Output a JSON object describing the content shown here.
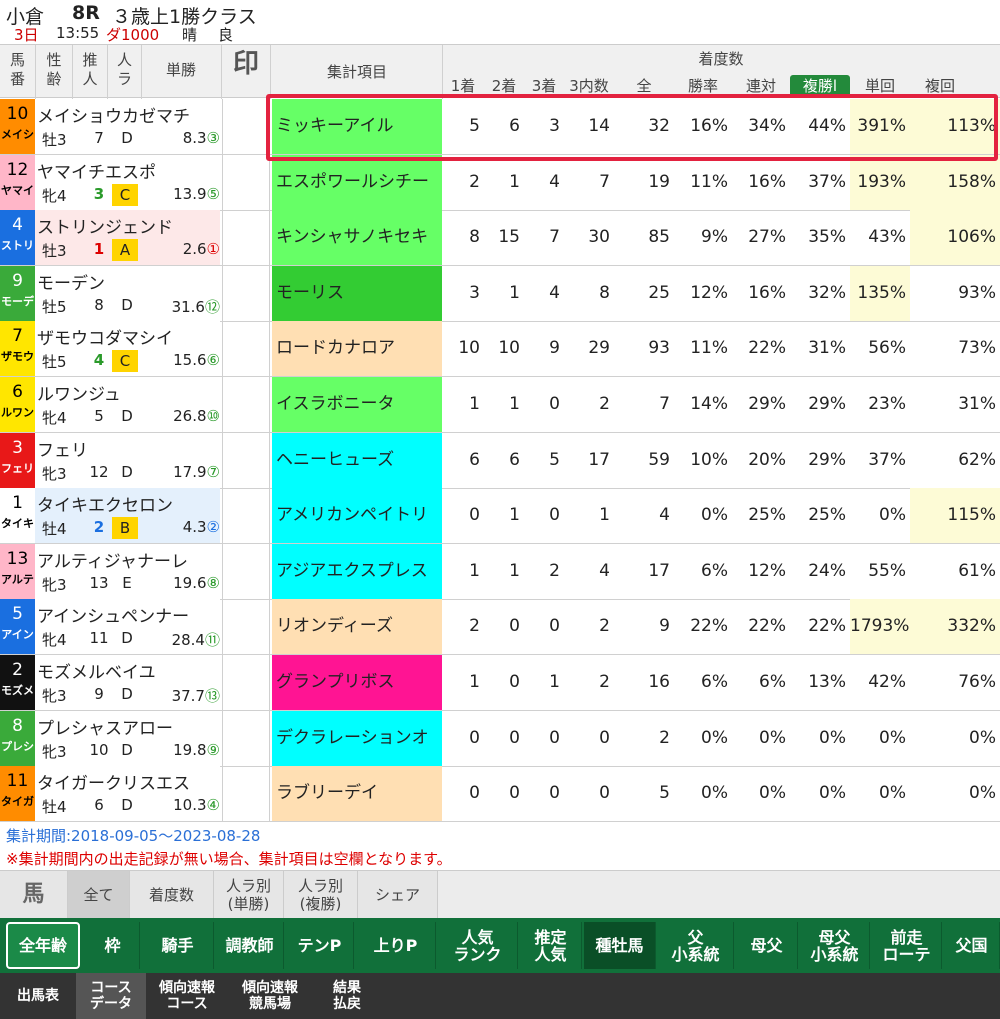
{
  "race": {
    "venue": "小倉",
    "number": "8R",
    "class": "３歳上1勝クラス",
    "day": "3日",
    "time": "13:55",
    "course": "ダ1000",
    "weather": "晴",
    "ground": "良"
  },
  "columns": {
    "umaban": "馬\n番",
    "seirei": "性\n齢",
    "suijin": "推\n人",
    "ninki": "人\nラ",
    "tansho": "単勝",
    "mark": "印",
    "item": "集計項目",
    "group": "着度数",
    "sub": [
      "1着",
      "2着",
      "3着",
      "3内数",
      "全",
      "勝率",
      "連対",
      "複勝l",
      "単回",
      "複回"
    ]
  },
  "horses": [
    {
      "num": "10",
      "abbr": "メイシ",
      "name": "メイショウカゼマチ",
      "sex": "牡3",
      "rec": "7",
      "rank": "D",
      "odds": "8.3",
      "ord": "③",
      "bg": "#ff8c00",
      "fg": "#000",
      "rowbg": "#ffffff",
      "highlight": false
    },
    {
      "num": "12",
      "abbr": "ヤマイ",
      "name": "ヤマイチエスポ",
      "sex": "牝4",
      "rec": "3",
      "rank": "C",
      "odds": "13.9",
      "ord": "⑤",
      "bg": "#ffb6c8",
      "fg": "#000",
      "rowbg": "#ffffff",
      "highlight": true
    },
    {
      "num": "4",
      "abbr": "ストリ",
      "name": "ストリンジェンド",
      "sex": "牡3",
      "rec": "1",
      "rank": "A",
      "odds": "2.6",
      "ord": "①",
      "bg": "#1a6fe0",
      "fg": "#fff",
      "rowbg": "#fde8e8",
      "highlight": true
    },
    {
      "num": "9",
      "abbr": "モーデ",
      "name": "モーデン",
      "sex": "牡5",
      "rec": "8",
      "rank": "D",
      "odds": "31.6",
      "ord": "⑫",
      "bg": "#3aaa3a",
      "fg": "#fff",
      "rowbg": "#ffffff",
      "highlight": false
    },
    {
      "num": "7",
      "abbr": "ザモウ",
      "name": "ザモウコダマシイ",
      "sex": "牡5",
      "rec": "4",
      "rank": "C",
      "odds": "15.6",
      "ord": "⑥",
      "bg": "#ffe600",
      "fg": "#000",
      "rowbg": "#ffffff",
      "highlight": true
    },
    {
      "num": "6",
      "abbr": "ルワン",
      "name": "ルワンジュ",
      "sex": "牝4",
      "rec": "5",
      "rank": "D",
      "odds": "26.8",
      "ord": "⑩",
      "bg": "#ffe600",
      "fg": "#000",
      "rowbg": "#ffffff",
      "highlight": false
    },
    {
      "num": "3",
      "abbr": "フェリ",
      "name": "フェリ",
      "sex": "牝3",
      "rec": "12",
      "rank": "D",
      "odds": "17.9",
      "ord": "⑦",
      "bg": "#e81818",
      "fg": "#fff",
      "rowbg": "#ffffff",
      "highlight": false
    },
    {
      "num": "1",
      "abbr": "タイキ",
      "name": "タイキエクセロン",
      "sex": "牡4",
      "rec": "2",
      "rank": "B",
      "odds": "4.3",
      "ord": "②",
      "bg": "#ffffff",
      "fg": "#000",
      "rowbg": "#e4f0fc",
      "highlight": true
    },
    {
      "num": "13",
      "abbr": "アルテ",
      "name": "アルティジャナーレ",
      "sex": "牝3",
      "rec": "13",
      "rank": "E",
      "odds": "19.6",
      "ord": "⑧",
      "bg": "#ffb6c8",
      "fg": "#000",
      "rowbg": "#ffffff",
      "highlight": false
    },
    {
      "num": "5",
      "abbr": "アイン",
      "name": "アインシュペンナー",
      "sex": "牝4",
      "rec": "11",
      "rank": "D",
      "odds": "28.4",
      "ord": "⑪",
      "bg": "#1a6fe0",
      "fg": "#fff",
      "rowbg": "#ffffff",
      "highlight": false
    },
    {
      "num": "2",
      "abbr": "モズメ",
      "name": "モズメルベイユ",
      "sex": "牝3",
      "rec": "9",
      "rank": "D",
      "odds": "37.7",
      "ord": "⑬",
      "bg": "#111111",
      "fg": "#fff",
      "rowbg": "#ffffff",
      "highlight": false
    },
    {
      "num": "8",
      "abbr": "プレシ",
      "name": "プレシャスアロー",
      "sex": "牝3",
      "rec": "10",
      "rank": "D",
      "odds": "19.8",
      "ord": "⑨",
      "bg": "#3aaa3a",
      "fg": "#fff",
      "rowbg": "#ffffff",
      "highlight": false
    },
    {
      "num": "11",
      "abbr": "タイガ",
      "name": "タイガークリスエス",
      "sex": "牡4",
      "rec": "6",
      "rank": "D",
      "odds": "10.3",
      "ord": "④",
      "bg": "#ff8c00",
      "fg": "#000",
      "rowbg": "#ffffff",
      "highlight": false
    }
  ],
  "stats": [
    {
      "sire": "ミッキーアイル",
      "color": "#66ff66",
      "v": [
        "5",
        "6",
        "3",
        "14",
        "32",
        "16%",
        "34%",
        "44%",
        "391%",
        "113%"
      ],
      "yel": [
        8,
        9
      ]
    },
    {
      "sire": "エスポワールシチー",
      "color": "#66ff66",
      "v": [
        "2",
        "1",
        "4",
        "7",
        "19",
        "11%",
        "16%",
        "37%",
        "193%",
        "158%"
      ],
      "yel": [
        8,
        9
      ]
    },
    {
      "sire": "キンシャサノキセキ",
      "color": "#66ff66",
      "v": [
        "8",
        "15",
        "7",
        "30",
        "85",
        "9%",
        "27%",
        "35%",
        "43%",
        "106%"
      ],
      "yel": [
        9
      ]
    },
    {
      "sire": "モーリス",
      "color": "#33cc33",
      "v": [
        "3",
        "1",
        "4",
        "8",
        "25",
        "12%",
        "16%",
        "32%",
        "135%",
        "93%"
      ],
      "yel": [
        8
      ]
    },
    {
      "sire": "ロードカナロア",
      "color": "#ffdfb3",
      "v": [
        "10",
        "10",
        "9",
        "29",
        "93",
        "11%",
        "22%",
        "31%",
        "56%",
        "73%"
      ],
      "yel": []
    },
    {
      "sire": "イスラボニータ",
      "color": "#66ff66",
      "v": [
        "1",
        "1",
        "0",
        "2",
        "7",
        "14%",
        "29%",
        "29%",
        "23%",
        "31%"
      ],
      "yel": []
    },
    {
      "sire": "ヘニーヒューズ",
      "color": "#00ffff",
      "v": [
        "6",
        "6",
        "5",
        "17",
        "59",
        "10%",
        "20%",
        "29%",
        "37%",
        "62%"
      ],
      "yel": []
    },
    {
      "sire": "アメリカンペイトリ",
      "color": "#00ffff",
      "v": [
        "0",
        "1",
        "0",
        "1",
        "4",
        "0%",
        "25%",
        "25%",
        "0%",
        "115%"
      ],
      "yel": [
        9
      ]
    },
    {
      "sire": "アジアエクスプレス",
      "color": "#00ffff",
      "v": [
        "1",
        "1",
        "2",
        "4",
        "17",
        "6%",
        "12%",
        "24%",
        "55%",
        "61%"
      ],
      "yel": []
    },
    {
      "sire": "リオンディーズ",
      "color": "#ffdfb3",
      "v": [
        "2",
        "0",
        "0",
        "2",
        "9",
        "22%",
        "22%",
        "22%",
        "1793%",
        "332%"
      ],
      "yel": [
        8,
        9
      ]
    },
    {
      "sire": "グランプリボス",
      "color": "#ff1493",
      "v": [
        "1",
        "0",
        "1",
        "2",
        "16",
        "6%",
        "6%",
        "13%",
        "42%",
        "76%"
      ],
      "yel": []
    },
    {
      "sire": "デクラレーションオ",
      "color": "#00ffff",
      "v": [
        "0",
        "0",
        "0",
        "0",
        "2",
        "0%",
        "0%",
        "0%",
        "0%",
        "0%"
      ],
      "yel": []
    },
    {
      "sire": "ラブリーデイ",
      "color": "#ffdfb3",
      "v": [
        "0",
        "0",
        "0",
        "0",
        "5",
        "0%",
        "0%",
        "0%",
        "0%",
        "0%"
      ],
      "yel": []
    }
  ],
  "notes": {
    "period": "集計期間:2018-09-05〜2023-08-28",
    "warning": "※集計期間内の出走記録が無い場合、集計項目は空欄となります。"
  },
  "tabs": {
    "uma": "馬",
    "items": [
      "全て",
      "着度数",
      "人ラ別\n(単勝)",
      "人ラ別\n(複勝)",
      "シェア"
    ]
  },
  "greennav": [
    "全年齢",
    "枠",
    "騎手",
    "調教師",
    "テンP",
    "上りP",
    "人気\nランク",
    "推定\n人気",
    "種牡馬",
    "父\n小系統",
    "母父",
    "母父\n小系統",
    "前走\nローテ",
    "父国"
  ],
  "bottomnav": [
    "出馬表",
    "コース\nデータ",
    "傾向速報\nコース",
    "傾向速報\n競馬場",
    "結果\n払戻"
  ]
}
